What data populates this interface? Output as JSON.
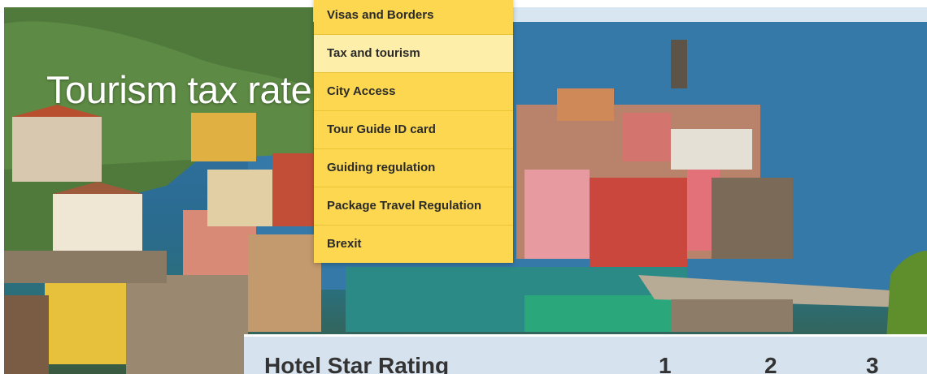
{
  "hero": {
    "title": "Tourism tax rate"
  },
  "menu": {
    "items": [
      {
        "label": "Visas and Borders",
        "hovered": false
      },
      {
        "label": "Tax and tourism",
        "hovered": true
      },
      {
        "label": "City Access",
        "hovered": false
      },
      {
        "label": "Tour Guide ID card",
        "hovered": false
      },
      {
        "label": "Guiding regulation",
        "hovered": false
      },
      {
        "label": "Package Travel Regulation",
        "hovered": false
      },
      {
        "label": "Brexit",
        "hovered": false
      }
    ]
  },
  "table": {
    "headers": [
      "Hotel Star Rating",
      "1",
      "2",
      "3"
    ]
  },
  "colors": {
    "menu_bg": "#fcd74f",
    "menu_hover": "#fdeeaa",
    "table_header_bg": "#d7e2ef"
  }
}
